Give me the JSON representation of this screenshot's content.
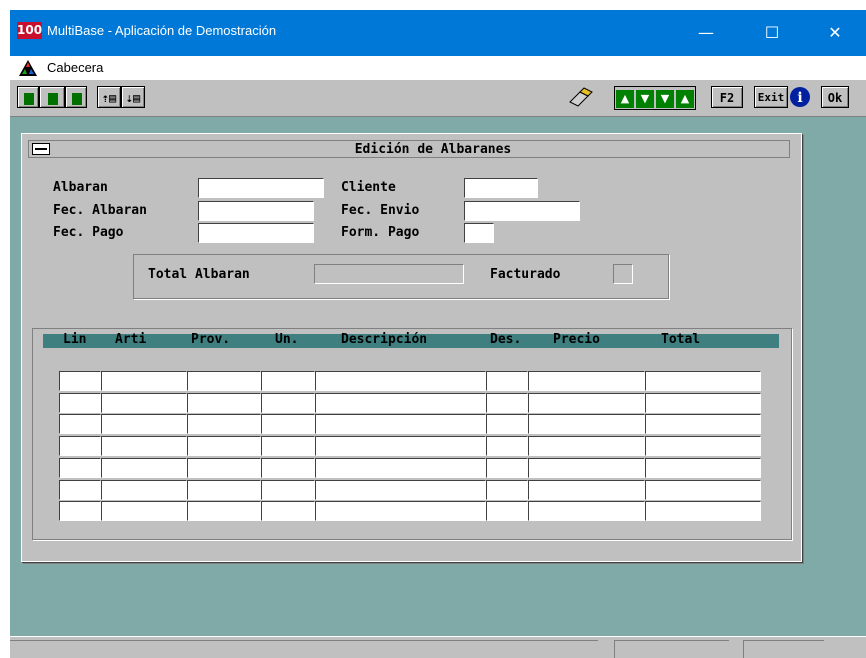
{
  "window": {
    "app_icon_text": "100",
    "title": "MultiBase - Aplicación de Demostración",
    "minimize_glyph": "—",
    "maximize_glyph": "☐",
    "close_glyph": "✕"
  },
  "menu": {
    "label": "Cabecera"
  },
  "toolbar": {
    "left_icons": [
      "insert-record-icon",
      "edit-record-icon",
      "delete-record-icon",
      "first-page-icon",
      "next-page-icon"
    ],
    "nav_icons": [
      "nav-up-icon",
      "nav-down-icon",
      "nav-last-icon",
      "nav-first-icon"
    ],
    "f2_label": "F2",
    "exit_label": "Exit",
    "info_glyph": "i",
    "ok_label": "Ok"
  },
  "form": {
    "title": "Edición de Albaranes",
    "labels": {
      "albaran": "Albaran",
      "fec_albaran": "Fec. Albaran",
      "fec_pago": "Fec. Pago",
      "cliente": "Cliente",
      "fec_envio": "Fec. Envio",
      "form_pago": "Form. Pago",
      "total_albaran": "Total Albaran",
      "facturado": "Facturado"
    },
    "values": {
      "albaran": "",
      "fec_albaran": "",
      "fec_pago": "",
      "cliente": "",
      "fec_envio": "",
      "form_pago": "",
      "total_albaran": "",
      "facturado": ""
    },
    "grid": {
      "columns": [
        "Lin",
        "Arti",
        "Prov.",
        "Un.",
        "Descripción",
        "Des.",
        "Precio",
        "Total"
      ],
      "rows": [
        [
          "",
          "",
          "",
          "",
          "",
          "",
          "",
          ""
        ],
        [
          "",
          "",
          "",
          "",
          "",
          "",
          "",
          ""
        ],
        [
          "",
          "",
          "",
          "",
          "",
          "",
          "",
          ""
        ],
        [
          "",
          "",
          "",
          "",
          "",
          "",
          "",
          ""
        ],
        [
          "",
          "",
          "",
          "",
          "",
          "",
          "",
          ""
        ],
        [
          "",
          "",
          "",
          "",
          "",
          "",
          "",
          ""
        ],
        [
          "",
          "",
          "",
          "",
          "",
          "",
          "",
          ""
        ]
      ]
    }
  },
  "colors": {
    "titlebar": "#0078d7",
    "desktop": "#80aaa8",
    "grid_header": "#3f7f7f",
    "nav_arrows": "#008000"
  }
}
